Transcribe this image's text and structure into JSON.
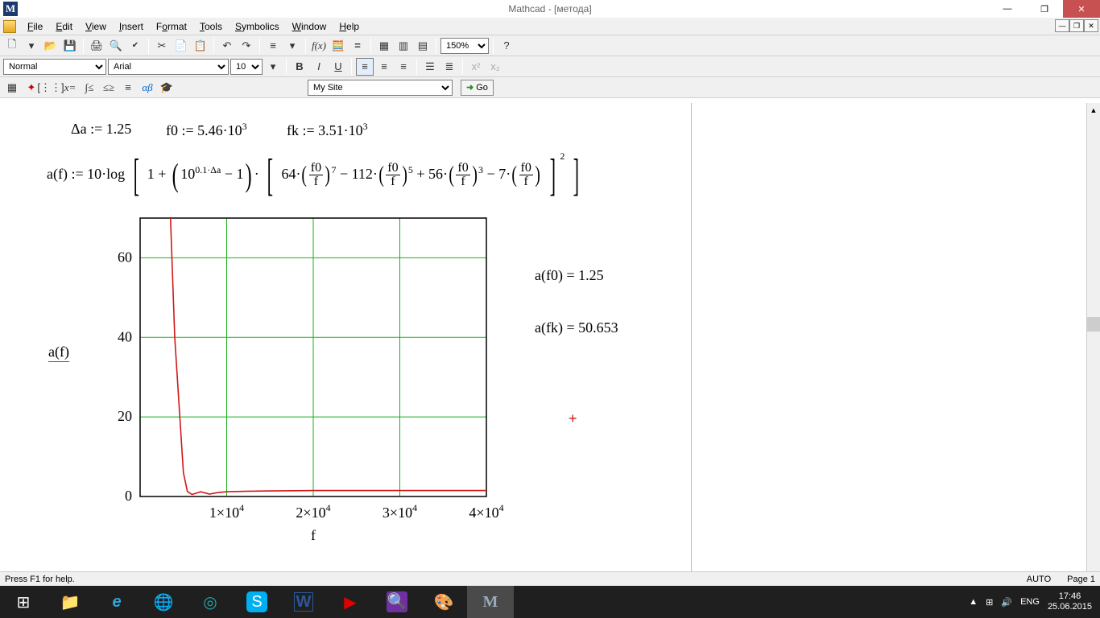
{
  "app": {
    "title": "Mathcad - [метода]",
    "icon_letter": "M"
  },
  "menu": {
    "items": [
      "File",
      "Edit",
      "View",
      "Insert",
      "Format",
      "Tools",
      "Symbolics",
      "Window",
      "Help"
    ]
  },
  "toolbar_std": {
    "zoom": "150%"
  },
  "toolbar_fmt": {
    "style": "Normal",
    "font": "Arial",
    "size": "10"
  },
  "toolbar_res": {
    "site": "My Site",
    "go": "Go"
  },
  "worksheet": {
    "defs": {
      "delta_a": "Δa := 1.25",
      "f0": "f0 := 5.46·10",
      "f0_exp": "3",
      "fk": "fk := 3.51·10",
      "fk_exp": "3"
    },
    "fn_label": "a(f) := 10·log",
    "results": {
      "r1": "a(f0) = 1.25",
      "r2": "a(fk) = 50.653"
    },
    "plot_ylabel": "a(f)",
    "plot_xlabel": "f"
  },
  "chart_data": {
    "type": "line",
    "title": "",
    "xlabel": "f",
    "ylabel": "a(f)",
    "xlim": [
      0,
      40000
    ],
    "ylim": [
      0,
      70
    ],
    "x_ticks": [
      10000,
      20000,
      30000,
      40000
    ],
    "x_tick_labels": [
      "1×10^4",
      "2×10^4",
      "3×10^4",
      "4×10^4"
    ],
    "y_ticks": [
      0,
      20,
      40,
      60
    ],
    "series": [
      {
        "name": "a(f)",
        "color": "#d01818",
        "x": [
          3510,
          4000,
          5000,
          5460,
          6000,
          7000,
          8000,
          9000,
          10000,
          12000,
          15000,
          20000,
          25000,
          30000,
          35000,
          40000
        ],
        "y": [
          70,
          40,
          6,
          1.25,
          0.5,
          1.2,
          0.6,
          1.0,
          1.2,
          1.3,
          1.4,
          1.5,
          1.5,
          1.5,
          1.5,
          1.5
        ]
      }
    ],
    "grid_color": "#16b016"
  },
  "status": {
    "left": "Press F1 for help.",
    "auto": "AUTO",
    "page": "Page 1"
  },
  "tray": {
    "lang": "ENG",
    "time": "17:46",
    "date": "25.06.2015"
  }
}
